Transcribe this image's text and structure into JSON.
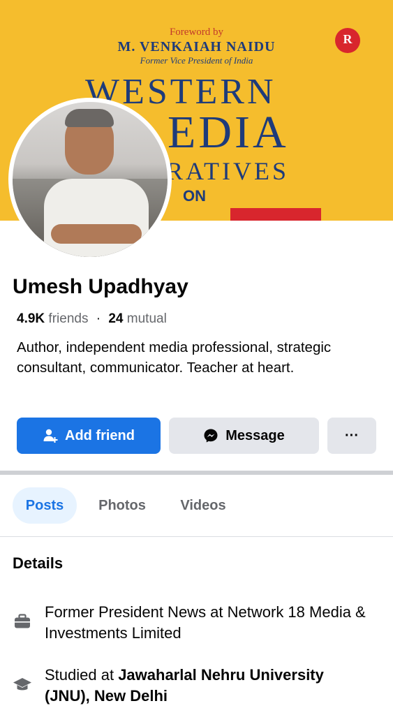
{
  "cover": {
    "foreword": "Foreword by",
    "author": "M. VENKAIAH NAIDU",
    "author_role": "Former Vice President of India",
    "title_line1": "WESTERN",
    "title_line2": "EDIA",
    "title_line3": "RATIVES",
    "title_line4": "ON",
    "publisher_mark": "R"
  },
  "profile": {
    "name": "Umesh Upadhyay",
    "friends_count": "4.9K",
    "friends_label": "friends",
    "separator": "·",
    "mutual_count": "24",
    "mutual_label": "mutual",
    "bio": "Author, independent media professional, strategic consultant, communicator. Teacher at heart."
  },
  "actions": {
    "add_friend": "Add friend",
    "message": "Message",
    "more": "···"
  },
  "tabs": [
    {
      "label": "Posts",
      "active": true
    },
    {
      "label": "Photos",
      "active": false
    },
    {
      "label": "Videos",
      "active": false
    }
  ],
  "details": {
    "title": "Details",
    "work": "Former President News at Network 18 Media & Investments Limited",
    "education_prefix": "Studied at ",
    "education_school": "Jawaharlal Nehru University (JNU), New Delhi"
  },
  "colors": {
    "primary": "#1b74e4",
    "cover_bg": "#f5bd2d",
    "button_secondary": "#e4e6eb",
    "muted_text": "#65676b"
  },
  "icons": [
    "add-friend-icon",
    "messenger-icon",
    "more-icon",
    "briefcase-icon",
    "graduation-cap-icon"
  ]
}
